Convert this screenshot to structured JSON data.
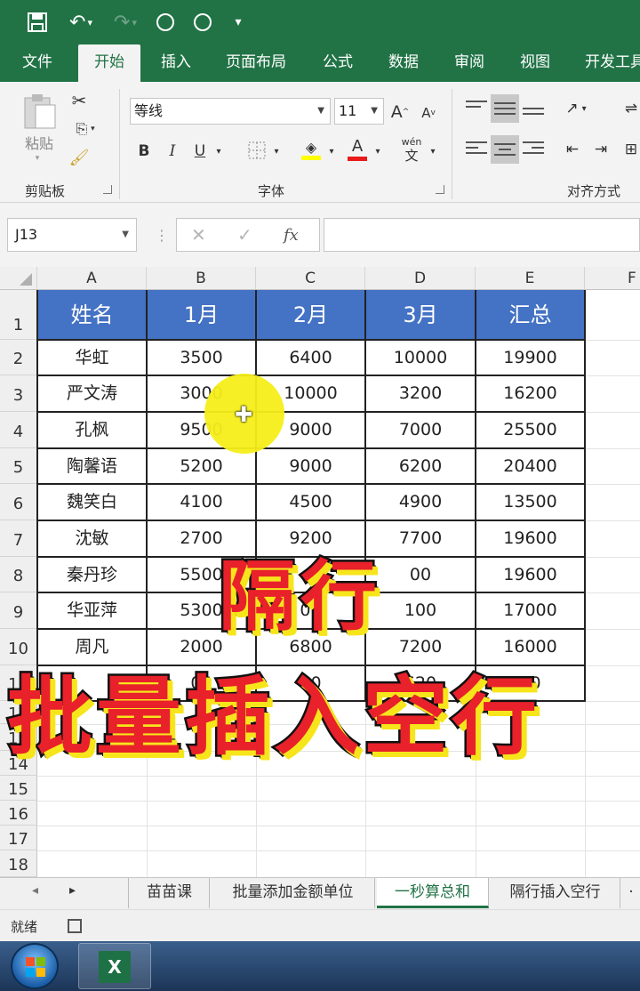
{
  "ribbon_tabs": [
    "文件",
    "开始",
    "插入",
    "页面布局",
    "公式",
    "数据",
    "审阅",
    "视图",
    "开发工具"
  ],
  "ribbon": {
    "paste_label": "粘贴",
    "clipboard_group": "剪贴板",
    "font_name": "等线",
    "font_size": "11",
    "font_group": "字体",
    "align_group": "对齐方式",
    "bold": "B",
    "italic": "I",
    "underline": "U",
    "grow_font": "A",
    "shrink_font": "A",
    "font_color": "A",
    "phonetic": "wén"
  },
  "formula_bar": {
    "name_box": "J13",
    "fx": "fx",
    "value": ""
  },
  "columns": [
    "A",
    "B",
    "C",
    "D",
    "E",
    "F"
  ],
  "row_numbers": [
    "1",
    "2",
    "3",
    "4",
    "5",
    "6",
    "7",
    "8",
    "9",
    "10",
    "11",
    "12",
    "13",
    "14",
    "15",
    "16",
    "17",
    "18"
  ],
  "table": {
    "headers": [
      "姓名",
      "1月",
      "2月",
      "3月",
      "汇总"
    ],
    "rows": [
      [
        "华虹",
        "3500",
        "6400",
        "10000",
        "19900"
      ],
      [
        "严文涛",
        "3000",
        "10000",
        "3200",
        "16200"
      ],
      [
        "孔枫",
        "9500",
        "9000",
        "7000",
        "25500"
      ],
      [
        "陶馨语",
        "5200",
        "9000",
        "6200",
        "20400"
      ],
      [
        "魏笑白",
        "4100",
        "4500",
        "4900",
        "13500"
      ],
      [
        "沈敏",
        "2700",
        "9200",
        "7700",
        "19600"
      ],
      [
        "秦丹珍",
        "5500",
        "",
        "00",
        "19600"
      ],
      [
        "华亚萍",
        "5300",
        "00",
        "100",
        "17000"
      ],
      [
        "周凡",
        "2000",
        "6800",
        "7200",
        "16000"
      ],
      [
        "",
        "00",
        "00",
        "620",
        "90"
      ]
    ]
  },
  "captions": {
    "line1": "隔行",
    "line2": "批量插入空行"
  },
  "sheet_tabs": [
    "苗苗课",
    "批量添加金额单位",
    "一秒算总和",
    "隔行插入空行"
  ],
  "active_sheet": "一秒算总和",
  "status": "就绪",
  "colors": {
    "excel_green": "#217346",
    "header_blue": "#4472c4",
    "caption_red": "#e8212b",
    "caption_yellow": "#f7e51b"
  }
}
